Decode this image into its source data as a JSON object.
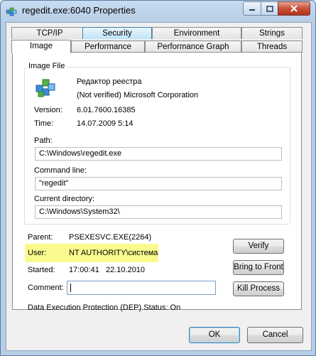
{
  "window": {
    "title": "regedit.exe:6040 Properties"
  },
  "tabs_back": [
    "TCP/IP",
    "Security",
    "Environment",
    "Strings"
  ],
  "tabs_front": [
    "Image",
    "Performance",
    "Performance Graph",
    "Threads"
  ],
  "image_file": {
    "group_label": "Image File",
    "description": "Редактор реестра",
    "company": "(Not verified) Microsoft Corporation",
    "version_label": "Version:",
    "version": "6.01.7600.16385",
    "time_label": "Time:",
    "time": "14.07.2009 5:14",
    "path_label": "Path:",
    "path": "C:\\Windows\\regedit.exe",
    "cmdline_label": "Command line:",
    "cmdline": "\"regedit\"",
    "curdir_label": "Current directory:",
    "curdir": "C:\\Windows\\System32\\"
  },
  "process": {
    "parent_label": "Parent:",
    "parent": "PSEXESVC.EXE(2264)",
    "user_label": "User:",
    "user": "NT AUTHORITY\\система",
    "started_label": "Started:",
    "started": "17:00:41   22.10.2010",
    "comment_label": "Comment:",
    "dep": "Data Execution Protection (DEP) Status:  On"
  },
  "buttons": {
    "verify": "Verify",
    "bring_to_front": "Bring to Front",
    "kill_process": "Kill Process",
    "ok": "OK",
    "cancel": "Cancel"
  },
  "colors": {
    "highlight": "#f9f98e",
    "tab_hover": "#bfe3f7"
  }
}
